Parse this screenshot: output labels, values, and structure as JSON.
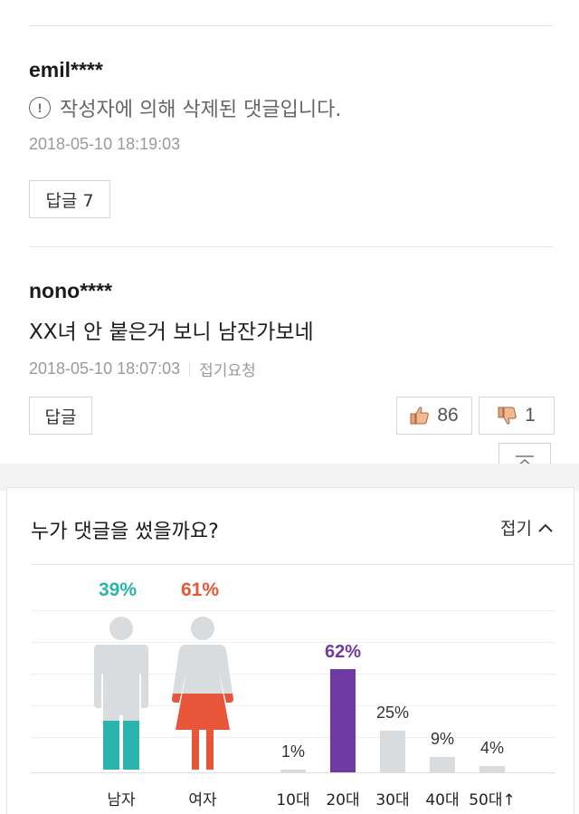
{
  "comments": [
    {
      "author": "emil****",
      "body": "작성자에 의해 삭제된 댓글입니다.",
      "deleted": true,
      "timestamp": "2018-05-10 18:19:03",
      "reply_label": "답글 7"
    },
    {
      "author": "nono****",
      "body": "XX녀 안 붙은거 보니 남잔가보네",
      "deleted": false,
      "timestamp": "2018-05-10 18:07:03",
      "report_label": "접기요청",
      "reply_label": "답글",
      "likes": "86",
      "dislikes": "1"
    }
  ],
  "stats": {
    "title": "누가 댓글을 썼을까요?",
    "fold_label": "접기",
    "gender": {
      "male": {
        "label": "남자",
        "percent": "39%",
        "value": 39,
        "color": "#2bb3ad"
      },
      "female": {
        "label": "여자",
        "percent": "61%",
        "value": 61,
        "color": "#e8563a"
      }
    },
    "age_chart": {
      "type": "bar",
      "categories": [
        "10대",
        "20대",
        "30대",
        "40대",
        "50대↑"
      ],
      "values": [
        1,
        62,
        25,
        9,
        4
      ],
      "labels": [
        "1%",
        "62%",
        "25%",
        "9%",
        "4%"
      ],
      "highlight_color": "#6f3aa4",
      "bar_color": "#d9dcde"
    }
  }
}
